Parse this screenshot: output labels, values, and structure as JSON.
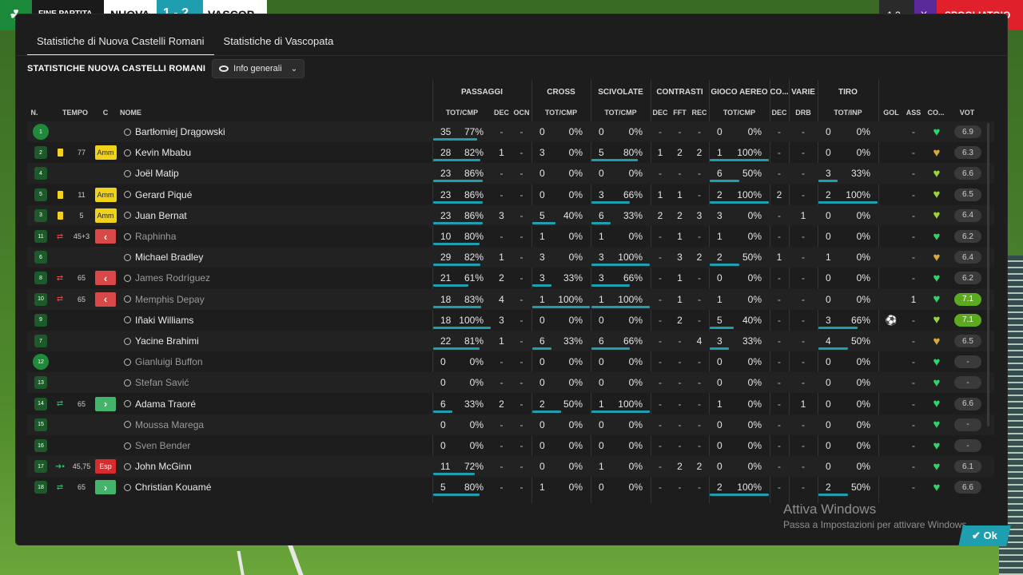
{
  "topbar": {
    "phase": "FINE PARTITA",
    "home": "NUOVA",
    "score": "1 - 2",
    "away": "VASCOP",
    "right1": "1 2",
    "right2": "X",
    "right3": "SPOGLIATOIO"
  },
  "tabs": [
    {
      "label": "Statistiche di Nuova Castelli Romani",
      "active": true
    },
    {
      "label": "Statistiche di Vascopata",
      "active": false
    }
  ],
  "section_title": "STATISTICHE NUOVA CASTELLI ROMANI",
  "view_dropdown": "Info generali",
  "groups": {
    "passaggi": "PASSAGGI",
    "cross": "CROSS",
    "scivolate": "SCIVOLATE",
    "contrasti": "CONTRASTI",
    "gioco_aereo": "GIOCO AEREO",
    "co": "CO...",
    "varie": "VARIE",
    "tiro": "TIRO"
  },
  "columns": {
    "n": "N.",
    "tempo": "TEMPO",
    "c": "C",
    "nome": "NOME",
    "pass_totcmp": "TOT/CMP",
    "pass_dec": "DEC",
    "pass_ocn": "OCN",
    "cross_totcmp": "TOT/CMP",
    "sciv_totcmp": "TOT/CMP",
    "contr_dec": "DEC",
    "contr_fft": "FFT",
    "contr_rec": "REC",
    "aereo_totcmp": "TOT/CMP",
    "co_dec": "DEC",
    "varie_drb": "DRB",
    "tiro_totinp": "TOT/INP",
    "gol": "GOL",
    "ass": "ASS",
    "cond": "CO...",
    "vot": "VOT"
  },
  "players": [
    {
      "num": "1",
      "gk": true,
      "evt": "",
      "time": "",
      "badge": "",
      "name": "Bartłomiej Drągowski",
      "dim": false,
      "pass": [
        "35",
        "77%",
        0.77
      ],
      "pass_dec": "-",
      "pass_ocn": "-",
      "cross": [
        "0",
        "0%",
        0
      ],
      "sciv": [
        "0",
        "0%",
        0
      ],
      "c_dec": "-",
      "c_fft": "-",
      "c_rec": "-",
      "aereo": [
        "0",
        "0%",
        0
      ],
      "co_dec": "-",
      "drb": "-",
      "tiro": [
        "0",
        "0%",
        0
      ],
      "gol": "",
      "ass": "-",
      "cond_color": "#2fd56a",
      "vot": "6.9",
      "vot_good": false
    },
    {
      "num": "2",
      "gk": false,
      "evt": "yellow",
      "time": "77",
      "badge": "Amm",
      "name": "Kevin Mbabu",
      "dim": false,
      "pass": [
        "28",
        "82%",
        0.82
      ],
      "pass_dec": "1",
      "pass_ocn": "-",
      "cross": [
        "3",
        "0%",
        0
      ],
      "sciv": [
        "5",
        "80%",
        0.8
      ],
      "c_dec": "1",
      "c_fft": "2",
      "c_rec": "2",
      "aereo": [
        "1",
        "100%",
        1
      ],
      "co_dec": "-",
      "drb": "-",
      "tiro": [
        "0",
        "0%",
        0
      ],
      "gol": "",
      "ass": "-",
      "cond_color": "#d9a93a",
      "vot": "6.3",
      "vot_good": false
    },
    {
      "num": "4",
      "gk": false,
      "evt": "",
      "time": "",
      "badge": "",
      "name": "Joël Matip",
      "dim": false,
      "pass": [
        "23",
        "86%",
        0.86
      ],
      "pass_dec": "-",
      "pass_ocn": "-",
      "cross": [
        "0",
        "0%",
        0
      ],
      "sciv": [
        "0",
        "0%",
        0
      ],
      "c_dec": "-",
      "c_fft": "-",
      "c_rec": "-",
      "aereo": [
        "6",
        "50%",
        0.5
      ],
      "co_dec": "-",
      "drb": "-",
      "tiro": [
        "3",
        "33%",
        0.33
      ],
      "gol": "",
      "ass": "-",
      "cond_color": "#9ad63a",
      "vot": "6.6",
      "vot_good": false
    },
    {
      "num": "5",
      "gk": false,
      "evt": "yellow",
      "time": "11",
      "badge": "Amm",
      "name": "Gerard Piqué",
      "dim": false,
      "pass": [
        "23",
        "86%",
        0.86
      ],
      "pass_dec": "-",
      "pass_ocn": "-",
      "cross": [
        "0",
        "0%",
        0
      ],
      "sciv": [
        "3",
        "66%",
        0.66
      ],
      "c_dec": "1",
      "c_fft": "1",
      "c_rec": "-",
      "aereo": [
        "2",
        "100%",
        1
      ],
      "co_dec": "2",
      "drb": "-",
      "tiro": [
        "2",
        "100%",
        1
      ],
      "gol": "",
      "ass": "-",
      "cond_color": "#9ad63a",
      "vot": "6.5",
      "vot_good": false
    },
    {
      "num": "3",
      "gk": false,
      "evt": "yellow",
      "time": "5",
      "badge": "Amm",
      "name": "Juan Bernat",
      "dim": false,
      "pass": [
        "23",
        "86%",
        0.86
      ],
      "pass_dec": "3",
      "pass_ocn": "-",
      "cross": [
        "5",
        "40%",
        0.4
      ],
      "sciv": [
        "6",
        "33%",
        0.33
      ],
      "c_dec": "2",
      "c_fft": "2",
      "c_rec": "3",
      "aereo": [
        "3",
        "0%",
        0
      ],
      "co_dec": "-",
      "drb": "1",
      "tiro": [
        "0",
        "0%",
        0
      ],
      "gol": "",
      "ass": "-",
      "cond_color": "#9ad63a",
      "vot": "6.4",
      "vot_good": false
    },
    {
      "num": "11",
      "gk": false,
      "evt": "subout",
      "time": "45+3",
      "badge": "out",
      "name": "Raphinha",
      "dim": true,
      "pass": [
        "10",
        "80%",
        0.8
      ],
      "pass_dec": "-",
      "pass_ocn": "-",
      "cross": [
        "1",
        "0%",
        0
      ],
      "sciv": [
        "1",
        "0%",
        0
      ],
      "c_dec": "-",
      "c_fft": "1",
      "c_rec": "-",
      "aereo": [
        "1",
        "0%",
        0
      ],
      "co_dec": "-",
      "drb": "-",
      "tiro": [
        "0",
        "0%",
        0
      ],
      "gol": "",
      "ass": "-",
      "cond_color": "#2fd56a",
      "vot": "6.2",
      "vot_good": false
    },
    {
      "num": "6",
      "gk": false,
      "evt": "",
      "time": "",
      "badge": "",
      "name": "Michael Bradley",
      "dim": false,
      "pass": [
        "29",
        "82%",
        0.82
      ],
      "pass_dec": "1",
      "pass_ocn": "-",
      "cross": [
        "3",
        "0%",
        0
      ],
      "sciv": [
        "3",
        "100%",
        1
      ],
      "c_dec": "-",
      "c_fft": "3",
      "c_rec": "2",
      "aereo": [
        "2",
        "50%",
        0.5
      ],
      "co_dec": "1",
      "drb": "-",
      "tiro": [
        "1",
        "0%",
        0
      ],
      "gol": "",
      "ass": "-",
      "cond_color": "#d9a93a",
      "vot": "6.4",
      "vot_good": false
    },
    {
      "num": "8",
      "gk": false,
      "evt": "subout",
      "time": "65",
      "badge": "out",
      "name": "James Rodríguez",
      "dim": true,
      "pass": [
        "21",
        "61%",
        0.61
      ],
      "pass_dec": "2",
      "pass_ocn": "-",
      "cross": [
        "3",
        "33%",
        0.33
      ],
      "sciv": [
        "3",
        "66%",
        0.66
      ],
      "c_dec": "-",
      "c_fft": "1",
      "c_rec": "-",
      "aereo": [
        "0",
        "0%",
        0
      ],
      "co_dec": "-",
      "drb": "-",
      "tiro": [
        "0",
        "0%",
        0
      ],
      "gol": "",
      "ass": "-",
      "cond_color": "#2fd56a",
      "vot": "6.2",
      "vot_good": false
    },
    {
      "num": "10",
      "gk": false,
      "evt": "subout",
      "time": "65",
      "badge": "out",
      "name": "Memphis Depay",
      "dim": true,
      "pass": [
        "18",
        "83%",
        0.83
      ],
      "pass_dec": "4",
      "pass_ocn": "-",
      "cross": [
        "1",
        "100%",
        1
      ],
      "sciv": [
        "1",
        "100%",
        1
      ],
      "c_dec": "-",
      "c_fft": "1",
      "c_rec": "-",
      "aereo": [
        "1",
        "0%",
        0
      ],
      "co_dec": "-",
      "drb": "-",
      "tiro": [
        "0",
        "0%",
        0
      ],
      "gol": "",
      "ass": "1",
      "cond_color": "#2fd56a",
      "vot": "7.1",
      "vot_good": true
    },
    {
      "num": "9",
      "gk": false,
      "evt": "",
      "time": "",
      "badge": "",
      "name": "Iñaki Williams",
      "dim": false,
      "pass": [
        "18",
        "100%",
        1
      ],
      "pass_dec": "3",
      "pass_ocn": "-",
      "cross": [
        "0",
        "0%",
        0
      ],
      "sciv": [
        "0",
        "0%",
        0
      ],
      "c_dec": "-",
      "c_fft": "2",
      "c_rec": "-",
      "aereo": [
        "5",
        "40%",
        0.4
      ],
      "co_dec": "-",
      "drb": "-",
      "tiro": [
        "3",
        "66%",
        0.66
      ],
      "gol": "⚽",
      "ass": "-",
      "cond_color": "#9ad63a",
      "vot": "7.1",
      "vot_good": true
    },
    {
      "num": "7",
      "gk": false,
      "evt": "",
      "time": "",
      "badge": "",
      "name": "Yacine Brahimi",
      "dim": false,
      "pass": [
        "22",
        "81%",
        0.81
      ],
      "pass_dec": "1",
      "pass_ocn": "-",
      "cross": [
        "6",
        "33%",
        0.33
      ],
      "sciv": [
        "6",
        "66%",
        0.66
      ],
      "c_dec": "-",
      "c_fft": "-",
      "c_rec": "4",
      "aereo": [
        "3",
        "33%",
        0.33
      ],
      "co_dec": "-",
      "drb": "-",
      "tiro": [
        "4",
        "50%",
        0.5
      ],
      "gol": "",
      "ass": "-",
      "cond_color": "#d9a93a",
      "vot": "6.5",
      "vot_good": false
    },
    {
      "num": "12",
      "gk": true,
      "evt": "",
      "time": "",
      "badge": "",
      "name": "Gianluigi Buffon",
      "dim": true,
      "pass": [
        "0",
        "0%",
        0
      ],
      "pass_dec": "-",
      "pass_ocn": "-",
      "cross": [
        "0",
        "0%",
        0
      ],
      "sciv": [
        "0",
        "0%",
        0
      ],
      "c_dec": "-",
      "c_fft": "-",
      "c_rec": "-",
      "aereo": [
        "0",
        "0%",
        0
      ],
      "co_dec": "-",
      "drb": "-",
      "tiro": [
        "0",
        "0%",
        0
      ],
      "gol": "",
      "ass": "-",
      "cond_color": "#2fd56a",
      "vot": "-",
      "vot_good": false
    },
    {
      "num": "13",
      "gk": false,
      "evt": "",
      "time": "",
      "badge": "",
      "name": "Stefan Savić",
      "dim": true,
      "pass": [
        "0",
        "0%",
        0
      ],
      "pass_dec": "-",
      "pass_ocn": "-",
      "cross": [
        "0",
        "0%",
        0
      ],
      "sciv": [
        "0",
        "0%",
        0
      ],
      "c_dec": "-",
      "c_fft": "-",
      "c_rec": "-",
      "aereo": [
        "0",
        "0%",
        0
      ],
      "co_dec": "-",
      "drb": "-",
      "tiro": [
        "0",
        "0%",
        0
      ],
      "gol": "",
      "ass": "-",
      "cond_color": "#2fd56a",
      "vot": "-",
      "vot_good": false
    },
    {
      "num": "14",
      "gk": false,
      "evt": "subin",
      "time": "65",
      "badge": "in",
      "name": "Adama Traoré",
      "dim": false,
      "pass": [
        "6",
        "33%",
        0.33
      ],
      "pass_dec": "2",
      "pass_ocn": "-",
      "cross": [
        "2",
        "50%",
        0.5
      ],
      "sciv": [
        "1",
        "100%",
        1
      ],
      "c_dec": "-",
      "c_fft": "-",
      "c_rec": "-",
      "aereo": [
        "1",
        "0%",
        0
      ],
      "co_dec": "-",
      "drb": "1",
      "tiro": [
        "0",
        "0%",
        0
      ],
      "gol": "",
      "ass": "-",
      "cond_color": "#2fd56a",
      "vot": "6.6",
      "vot_good": false
    },
    {
      "num": "15",
      "gk": false,
      "evt": "",
      "time": "",
      "badge": "",
      "name": "Moussa Marega",
      "dim": true,
      "pass": [
        "0",
        "0%",
        0
      ],
      "pass_dec": "-",
      "pass_ocn": "-",
      "cross": [
        "0",
        "0%",
        0
      ],
      "sciv": [
        "0",
        "0%",
        0
      ],
      "c_dec": "-",
      "c_fft": "-",
      "c_rec": "-",
      "aereo": [
        "0",
        "0%",
        0
      ],
      "co_dec": "-",
      "drb": "-",
      "tiro": [
        "0",
        "0%",
        0
      ],
      "gol": "",
      "ass": "-",
      "cond_color": "#2fd56a",
      "vot": "-",
      "vot_good": false
    },
    {
      "num": "16",
      "gk": false,
      "evt": "",
      "time": "",
      "badge": "",
      "name": "Sven Bender",
      "dim": true,
      "pass": [
        "0",
        "0%",
        0
      ],
      "pass_dec": "-",
      "pass_ocn": "-",
      "cross": [
        "0",
        "0%",
        0
      ],
      "sciv": [
        "0",
        "0%",
        0
      ],
      "c_dec": "-",
      "c_fft": "-",
      "c_rec": "-",
      "aereo": [
        "0",
        "0%",
        0
      ],
      "co_dec": "-",
      "drb": "-",
      "tiro": [
        "0",
        "0%",
        0
      ],
      "gol": "",
      "ass": "-",
      "cond_color": "#2fd56a",
      "vot": "-",
      "vot_good": false
    },
    {
      "num": "17",
      "gk": false,
      "evt": "subred",
      "time": "45,75",
      "badge": "Esp",
      "name": "John McGinn",
      "dim": false,
      "pass": [
        "11",
        "72%",
        0.72
      ],
      "pass_dec": "-",
      "pass_ocn": "-",
      "cross": [
        "0",
        "0%",
        0
      ],
      "sciv": [
        "1",
        "0%",
        0
      ],
      "c_dec": "-",
      "c_fft": "2",
      "c_rec": "2",
      "aereo": [
        "0",
        "0%",
        0
      ],
      "co_dec": "-",
      "drb": "-",
      "tiro": [
        "0",
        "0%",
        0
      ],
      "gol": "",
      "ass": "-",
      "cond_color": "#2fd56a",
      "vot": "6.1",
      "vot_good": false
    },
    {
      "num": "18",
      "gk": false,
      "evt": "subin",
      "time": "65",
      "badge": "in",
      "name": "Christian Kouamé",
      "dim": false,
      "pass": [
        "5",
        "80%",
        0.8
      ],
      "pass_dec": "-",
      "pass_ocn": "-",
      "cross": [
        "1",
        "0%",
        0
      ],
      "sciv": [
        "0",
        "0%",
        0
      ],
      "c_dec": "-",
      "c_fft": "-",
      "c_rec": "-",
      "aereo": [
        "2",
        "100%",
        1
      ],
      "co_dec": "-",
      "drb": "-",
      "tiro": [
        "2",
        "50%",
        0.5
      ],
      "gol": "",
      "ass": "-",
      "cond_color": "#2fd56a",
      "vot": "6.6",
      "vot_good": false
    }
  ],
  "ok_label": "Ok",
  "watermark": {
    "title": "Attiva Windows",
    "subtitle": "Passa a Impostazioni per attivare Windows."
  }
}
